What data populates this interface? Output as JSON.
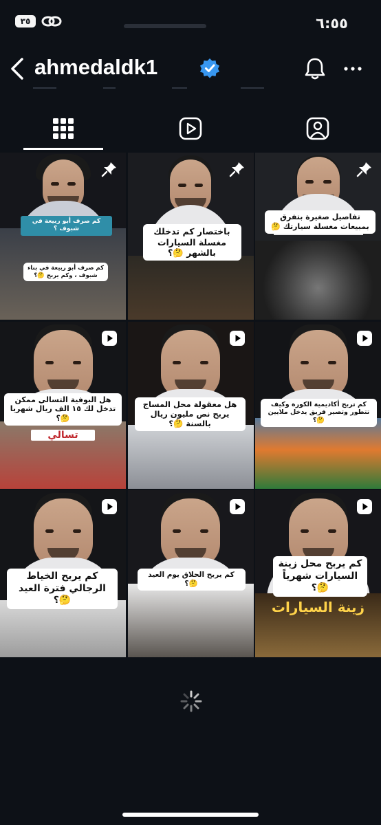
{
  "status_bar": {
    "time": "٦:٥٥",
    "battery": "٣٥"
  },
  "header": {
    "username": "ahmedaldk1"
  },
  "icons": {
    "back": "chevron-left-icon",
    "verified": "verified-badge-icon",
    "bell": "bell-icon",
    "more": "more-icon",
    "grid_tab": "grid-icon",
    "reels_tab": "reels-icon",
    "tagged_tab": "tagged-icon",
    "pin": "pin-icon",
    "reel": "reel-icon",
    "loading": "loading-spinner-icon"
  },
  "posts": [
    {
      "badge": "pin",
      "caption": "كم صرف أبو ربيعة في شبوف ؟",
      "caption2": "كم صرف أبو ربيعة في بناء شبوف ، وكم يربح 🤔؟"
    },
    {
      "badge": "pin",
      "caption": "باختصار كم تدخلك مغسلة السيارات بالشهر 🤔؟"
    },
    {
      "badge": "pin",
      "caption": "تفاصيل صغيرة بتفرق بمبيعات مغسلة سيارتك 🤔"
    },
    {
      "badge": "reel",
      "caption": "هل البوفية التسالي ممكن تدخل لك ١٥ الف ريال شهريا 🤔؟",
      "sign": "تسالي"
    },
    {
      "badge": "reel",
      "caption": "هل معقولة محل المساج يربح نص مليون ريال بالسنة 🤔؟"
    },
    {
      "badge": "reel",
      "caption": "كم تربح أكاديمية الكورة وكيف تتطور وتصير فريق يدخل ملايين 🤔؟"
    },
    {
      "badge": "reel",
      "caption": "كم يربح الخياط الرجالي فترة العيد 🤔؟"
    },
    {
      "badge": "reel",
      "caption": "كم يربح الحلاق يوم العيد 🤔؟"
    },
    {
      "badge": "reel",
      "caption": "كم يربح محل زينة السيارات شهرياً 🤔؟",
      "sign": "زينة السيارات"
    }
  ]
}
